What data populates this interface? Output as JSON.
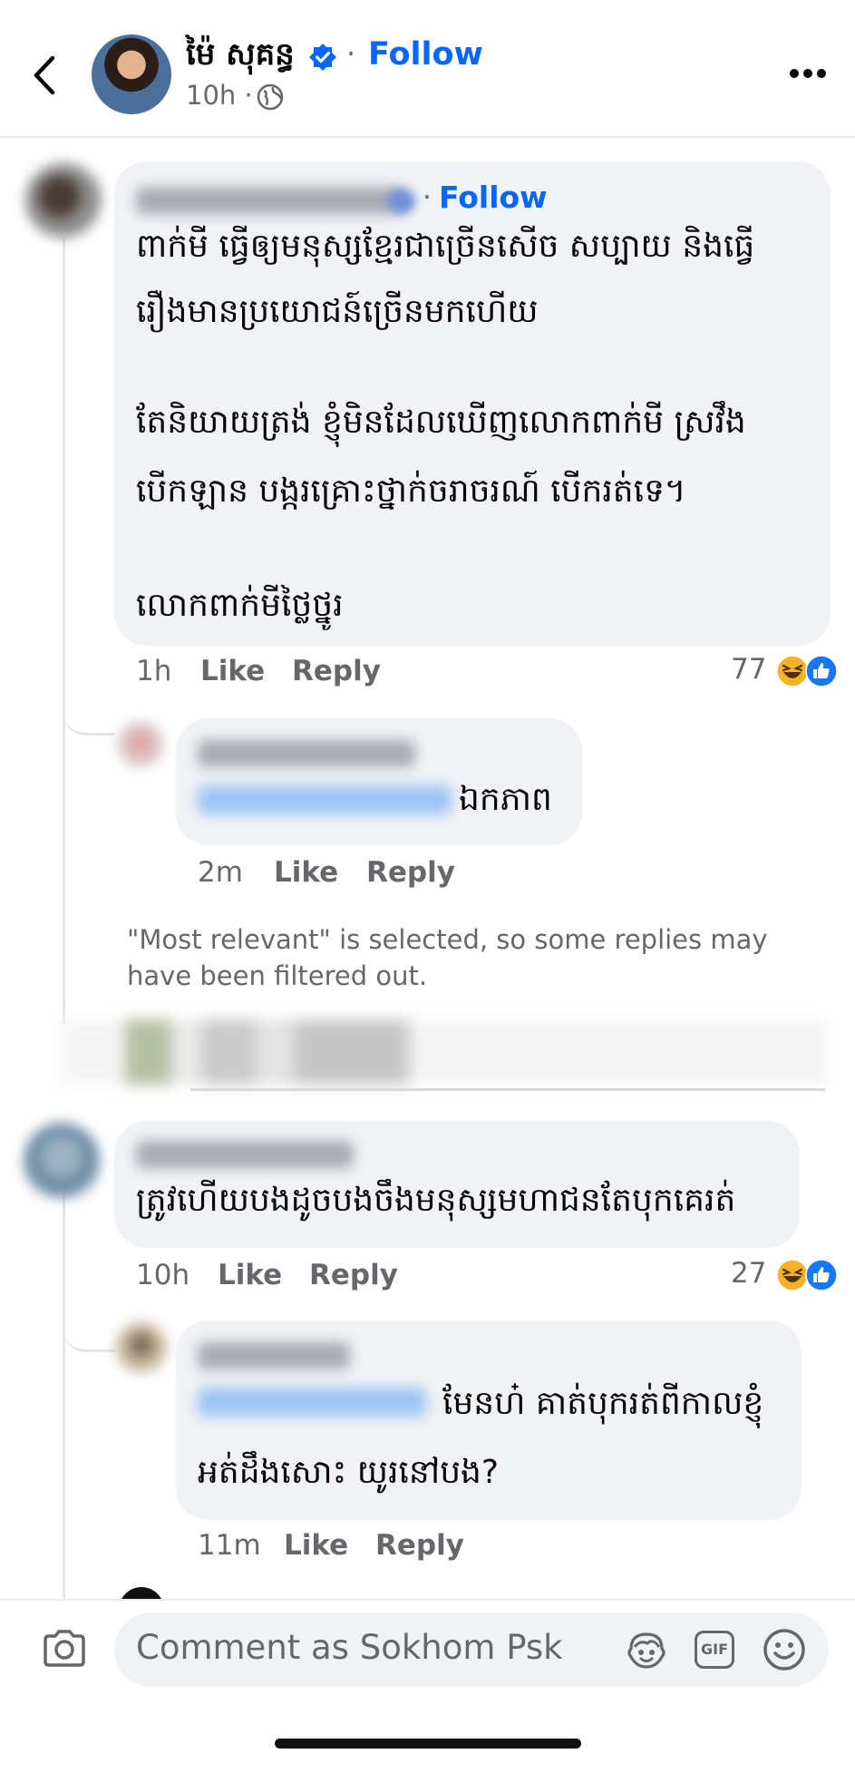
{
  "header": {
    "author_name": "ម៉ៃ សុគន្ធ",
    "separator": "·",
    "follow_label": "Follow",
    "timestamp": "10h ·"
  },
  "comments": [
    {
      "follow_label": "Follow",
      "separator": "·",
      "lines": [
        "ពាក់មី ធ្វើឲ្យមនុស្សខ្មែរជាច្រើនសើច សប្បាយ និងធ្វើ",
        "រឿងមានប្រយោជន៍ច្រើនមកហើយ",
        "តែនិយាយត្រង់ ខ្ញុំមិនដែលឃើញលោកពាក់មី ស្រវឹង",
        "បើកឡាន បង្ករគ្រោះថ្នាក់ចរាចរណ៍ បើករត់ទេ។",
        "លោកពាក់មីថ្លៃថ្នូរ"
      ],
      "time": "1h",
      "like_label": "Like",
      "reply_label": "Reply",
      "reaction_count": "77"
    },
    {
      "text": "ឯកភាព",
      "time": "2m",
      "like_label": "Like",
      "reply_label": "Reply"
    },
    {
      "text": "ត្រូវហើយបងដូចបងចឹងមនុស្សមហាជនតែបុកគេរត់",
      "time": "10h",
      "like_label": "Like",
      "reply_label": "Reply",
      "reaction_count": "27"
    },
    {
      "lines": [
        "មែនហ៎ គាត់បុករត់ពីកាលខ្ញុំ",
        "អត់ដឹងសោះ យូរនៅបង?"
      ],
      "time": "11m",
      "like_label": "Like",
      "reply_label": "Reply"
    }
  ],
  "filter_notice": "\"Most relevant\" is selected, so some replies may have been filtered out.",
  "composer": {
    "placeholder": "Comment as Sokhom Psk",
    "gif_label": "GIF"
  },
  "colors": {
    "accent": "#0866ff",
    "bubble": "#f0f2f5",
    "muted_text": "#65676b"
  },
  "icons": [
    "back-icon",
    "verified-badge-icon",
    "globe-icon",
    "more-options-icon",
    "laugh-reaction-icon",
    "like-reaction-icon",
    "camera-icon",
    "avatar-sticker-icon",
    "gif-icon",
    "emoji-icon"
  ]
}
